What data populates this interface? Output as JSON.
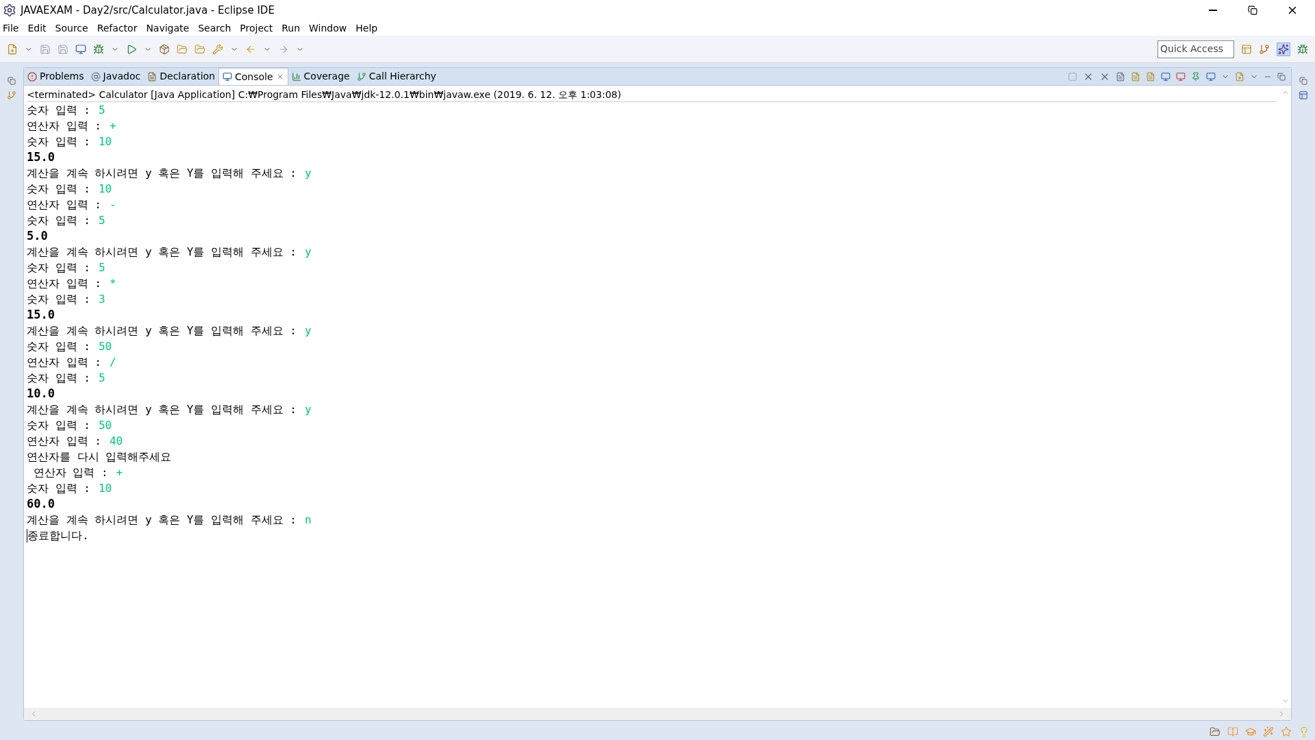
{
  "window": {
    "title": "JAVAEXAM - Day2/src/Calculator.java - Eclipse IDE"
  },
  "menu": [
    "File",
    "Edit",
    "Source",
    "Refactor",
    "Navigate",
    "Search",
    "Project",
    "Run",
    "Window",
    "Help"
  ],
  "quick_access": {
    "placeholder": "Quick Access"
  },
  "tabs": [
    {
      "label": "Problems",
      "selected": false
    },
    {
      "label": "Javadoc",
      "selected": false
    },
    {
      "label": "Declaration",
      "selected": false
    },
    {
      "label": "Console",
      "selected": true
    },
    {
      "label": "Coverage",
      "selected": false
    },
    {
      "label": "Call Hierarchy",
      "selected": false
    }
  ],
  "console": {
    "header": "<terminated> Calculator [Java Application] C:₩Program Files₩Java₩jdk-12.0.1₩bin₩javaw.exe (2019. 6. 12. 오후 1:03:08)",
    "lines": [
      {
        "kind": "prompt",
        "text": "숫자 입력 :",
        "input": "5"
      },
      {
        "kind": "prompt",
        "text": "연산자 입력 :",
        "input": "+"
      },
      {
        "kind": "prompt",
        "text": "숫자 입력 :",
        "input": "10"
      },
      {
        "kind": "result",
        "text": "15.0"
      },
      {
        "kind": "prompt",
        "text": "계산을 계속 하시려면 y 혹은 Y를 입력해 주세요 :",
        "input": "y"
      },
      {
        "kind": "prompt",
        "text": "숫자 입력 :",
        "input": "10"
      },
      {
        "kind": "prompt",
        "text": "연산자 입력 :",
        "input": "-"
      },
      {
        "kind": "prompt",
        "text": "숫자 입력 :",
        "input": "5"
      },
      {
        "kind": "result",
        "text": "5.0"
      },
      {
        "kind": "prompt",
        "text": "계산을 계속 하시려면 y 혹은 Y를 입력해 주세요 :",
        "input": "y"
      },
      {
        "kind": "prompt",
        "text": "숫자 입력 :",
        "input": "5"
      },
      {
        "kind": "prompt",
        "text": "연산자 입력 :",
        "input": "*"
      },
      {
        "kind": "prompt",
        "text": "숫자 입력 :",
        "input": "3"
      },
      {
        "kind": "result",
        "text": "15.0"
      },
      {
        "kind": "prompt",
        "text": "계산을 계속 하시려면 y 혹은 Y를 입력해 주세요 :",
        "input": "y"
      },
      {
        "kind": "prompt",
        "text": "숫자 입력 :",
        "input": "50"
      },
      {
        "kind": "prompt",
        "text": "연산자 입력 :",
        "input": "/"
      },
      {
        "kind": "prompt",
        "text": "숫자 입력 :",
        "input": "5"
      },
      {
        "kind": "result",
        "text": "10.0"
      },
      {
        "kind": "prompt",
        "text": "계산을 계속 하시려면 y 혹은 Y를 입력해 주세요 :",
        "input": "y"
      },
      {
        "kind": "prompt",
        "text": "숫자 입력 :",
        "input": "50"
      },
      {
        "kind": "prompt",
        "text": "연산자 입력 :",
        "input": "40"
      },
      {
        "kind": "message",
        "text": "연산자를 다시 입력해주세요"
      },
      {
        "kind": "prompt",
        "text": " 연산자 입력 :",
        "input": "+"
      },
      {
        "kind": "prompt",
        "text": "숫자 입력 :",
        "input": "10"
      },
      {
        "kind": "result",
        "text": "60.0"
      },
      {
        "kind": "prompt",
        "text": "계산을 계속 하시려면 y 혹은 Y를 입력해 주세요 :",
        "input": "n"
      },
      {
        "kind": "message",
        "text": "종료합니다.",
        "cursor": true
      }
    ]
  }
}
